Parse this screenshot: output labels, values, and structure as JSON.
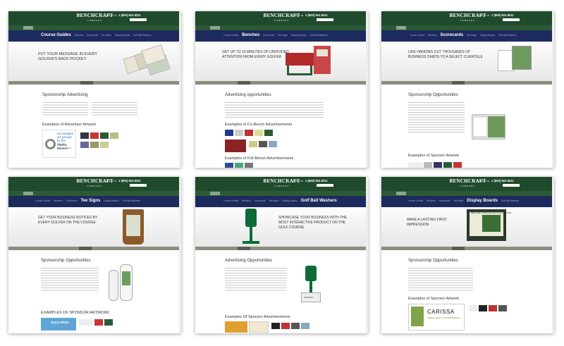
{
  "brand": {
    "name": "BENCHCRAFT",
    "tagline": "COMPANY"
  },
  "common": {
    "call_label": "Call us at",
    "phone": "1 (800) 824 8311"
  },
  "cards": [
    {
      "nav_active": "Course Guides",
      "nav_items": [
        "Benches",
        "Scorecards",
        "Tee Signs",
        "Display Boards",
        "Golf Ball Washers"
      ],
      "hero_text": "PUT YOUR MESSAGE IN EVERY GOLFER'S BACK POCKET.",
      "section_title": "Sponsorship Advertising",
      "examples_title": "Examples of Advertiser Artwork",
      "ad_headline": "Our designs are just par for the course.",
      "ad_brand": "Sterling Brothers",
      "ad_brand_sub": "FINE JEWELRY"
    },
    {
      "nav_items_before": [
        "Course Guides"
      ],
      "nav_active": "Benches",
      "nav_items": [
        "Scorecards",
        "Tee Signs",
        "Display Boards",
        "Golf Ball Washers"
      ],
      "hero_text": "GET UP TO 10 MINUTES OF UNDIVIDED ATTENTION FROM EVERY GOLFER",
      "section_title": "Advertising opportunities",
      "examples_title": "Examples of Co-Bench Advertisements",
      "examples_title_2": "Examples of Full-Bench Advertisements"
    },
    {
      "nav_items_before": [
        "Course Guides",
        "Benches"
      ],
      "nav_active": "Scorecards",
      "nav_items": [
        "Tee Signs",
        "Display Boards",
        "Golf Ball Washers"
      ],
      "hero_text": "LIKE HANDING OUT THOUSANDS OF BUSINESS CARDS TO A SELECT CLIENTELE",
      "section_title": "Sponsorship Opportunities",
      "examples_title": "Examples of Sponsor Artwork"
    },
    {
      "nav_items_before": [
        "Course Guides",
        "Benches",
        "Scorecards"
      ],
      "nav_active": "Tee Signs",
      "nav_items": [
        "Display Boards",
        "Golf Ball Washers"
      ],
      "hero_text": "GET YOUR BUSINESS NOTICED BY EVERY GOLFER ON THE COURSE",
      "section_title": "Sponsorship Opportunities",
      "examples_title": "EXAMPLES OF SPONSOR ARTWORK",
      "ad_brand": "Stacy White"
    },
    {
      "nav_items_before": [
        "Course Guides",
        "Benches",
        "Scorecards",
        "Tee Signs",
        "Display Boards"
      ],
      "nav_active": "Golf Ball Washers",
      "nav_items": [],
      "hero_text": "SHOWCASE YOUR BUSINESS WITH THE MOST INTERACTIVE PRODUCT ON THE GOLF COURSE",
      "section_title": "Advertising Opportunities",
      "examples_title": "Examples Of Sponsor Advertisements",
      "washer_label": "OFFICIAL"
    },
    {
      "nav_items_before": [
        "Course Guides",
        "Benches",
        "Scorecards",
        "Tee Signs"
      ],
      "nav_active": "Display Boards",
      "nav_items": [
        "Golf Ball Washers"
      ],
      "hero_text": "MAKE A LASTING FIRST IMPRESSION",
      "section_title": "Sponsorship Opportunities",
      "examples_title": "Examples of Sponsor Artwork",
      "board_title": "WELCOME TO ROLLING HILLS GOLF COURSE",
      "ad_brand": "CARISSA",
      "ad_brand_sub": "FRESH FOOD IN CONVENIENCE"
    }
  ],
  "colors": {
    "header_green": "#1f4a2c",
    "nav_navy": "#1d2a5e",
    "tab_gray": "#8c8c80",
    "washer_green": "#0d6b37",
    "bench_red": "#b02a2a"
  }
}
